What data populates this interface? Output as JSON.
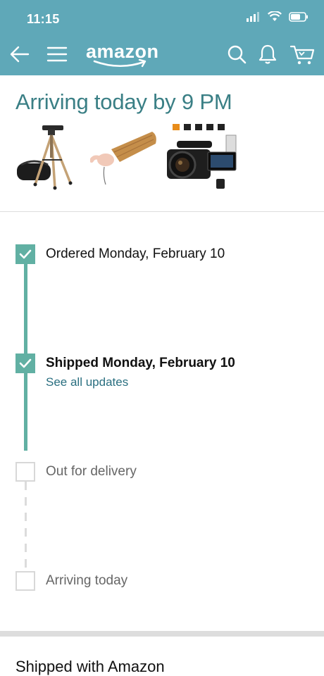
{
  "status": {
    "time": "11:15"
  },
  "navbar": {
    "logo": "amazon"
  },
  "shipment": {
    "title": "Arriving today by 9 PM",
    "products": [
      {
        "name": "tripod-image"
      },
      {
        "name": "wooden-paddle-image"
      },
      {
        "name": "camcorder-image"
      }
    ]
  },
  "timeline": {
    "steps": [
      {
        "label": "Ordered Monday, February 10",
        "done": true
      },
      {
        "label": "Shipped Monday, February 10",
        "done": true,
        "link": "See all updates"
      },
      {
        "label": "Out for delivery",
        "done": false
      },
      {
        "label": "Arriving today",
        "done": false
      }
    ]
  },
  "footer": {
    "title": "Shipped with Amazon"
  },
  "colors": {
    "header": "#5fa8b8",
    "title": "#3a7f85",
    "progress": "#61b0a3",
    "link": "#2a6f80"
  }
}
